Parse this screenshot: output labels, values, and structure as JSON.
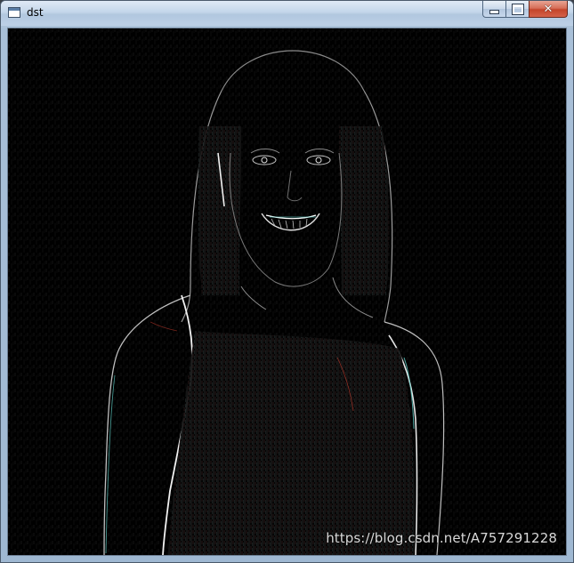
{
  "window": {
    "title": "dst"
  },
  "caption_buttons": {
    "minimize": "minimize",
    "maximize": "maximize",
    "close": "✕"
  },
  "content": {
    "image_description_icon": "edge-detected-portrait-image",
    "watermark": "https://blog.csdn.net/A757291228"
  },
  "colors": {
    "background": "#000000",
    "edge_white": "#e6e6e6",
    "edge_cyan": "#5fd0c8",
    "edge_red": "#c0392b"
  }
}
